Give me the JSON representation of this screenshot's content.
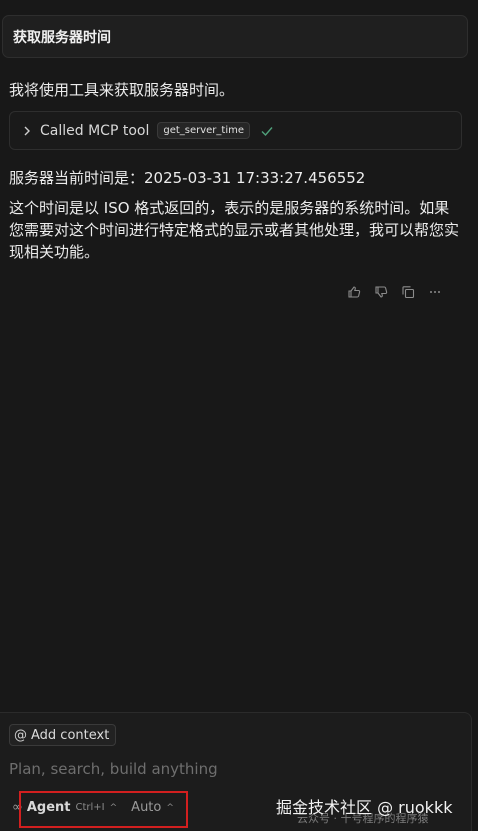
{
  "chat": {
    "user_message": "获取服务器时间",
    "assistant_intro": "我将使用工具来获取服务器时间。",
    "tool_call": {
      "label": "Called MCP tool",
      "tool_name": "get_server_time"
    },
    "server_time_line": "服务器当前时间是：2025-03-31 17:33:27.456552",
    "explanation": "这个时间是以 ISO 格式返回的，表示的是服务器的系统时间。如果您需要对这个时间进行特定格式的显示或者其他处理，我可以帮您实现相关功能。"
  },
  "composer": {
    "add_context_label": "Add context",
    "placeholder": "Plan, search, build anything",
    "mode_label": "Agent",
    "mode_shortcut": "Ctrl+I",
    "model_label": "Auto"
  },
  "watermark": {
    "text": "掘金技术社区 @ ruokkk",
    "sub_text": "云众号 · 十号程序的程序猿"
  },
  "colors": {
    "background": "#181818",
    "highlight_border": "#d21f1f",
    "check_color": "#4fa07a"
  }
}
